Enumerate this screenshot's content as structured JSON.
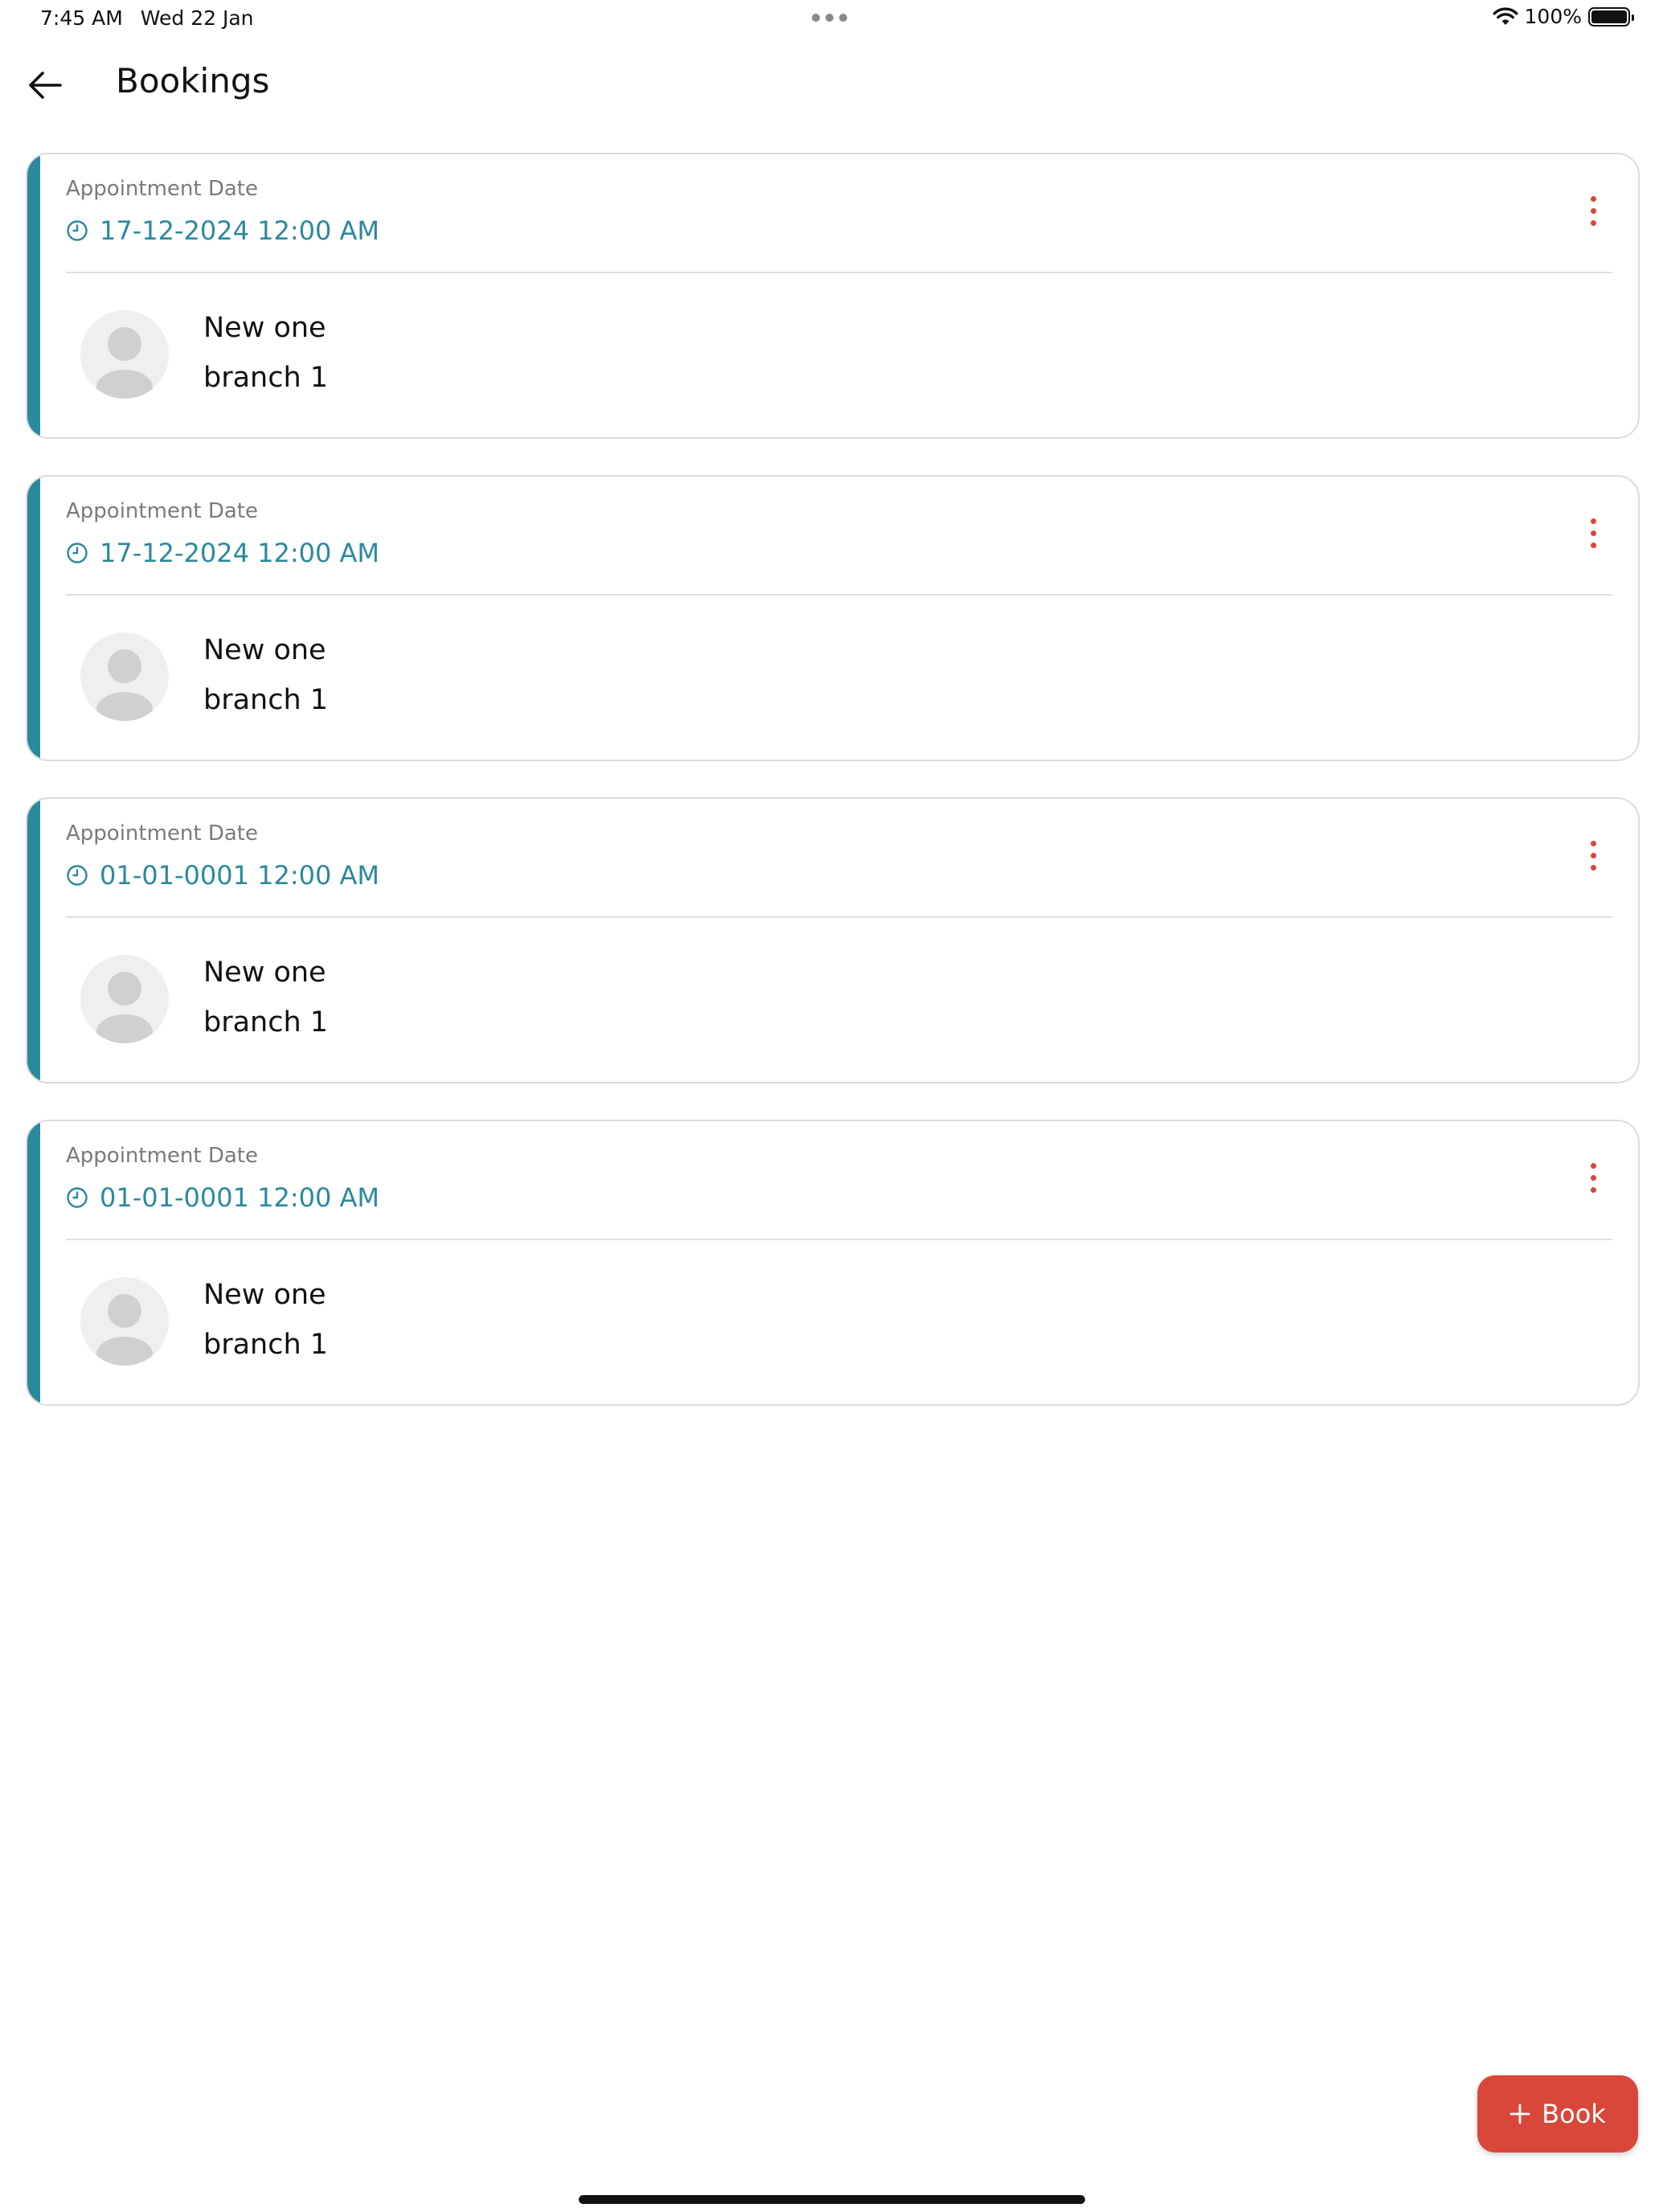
{
  "status_bar": {
    "time": "7:45 AM",
    "date": "Wed 22 Jan",
    "battery": "100%"
  },
  "header": {
    "title": "Bookings"
  },
  "colors": {
    "accent": "#2a8a9c",
    "action": "#d9473a"
  },
  "bookings": [
    {
      "label": "Appointment Date",
      "date": "17-12-2024 12:00 AM",
      "name": "New one",
      "branch": "branch 1"
    },
    {
      "label": "Appointment Date",
      "date": "17-12-2024 12:00 AM",
      "name": "New one",
      "branch": "branch 1"
    },
    {
      "label": "Appointment Date",
      "date": "01-01-0001 12:00 AM",
      "name": "New one",
      "branch": "branch 1"
    },
    {
      "label": "Appointment Date",
      "date": "01-01-0001 12:00 AM",
      "name": "New one",
      "branch": "branch 1"
    }
  ],
  "fab": {
    "label": "Book"
  }
}
